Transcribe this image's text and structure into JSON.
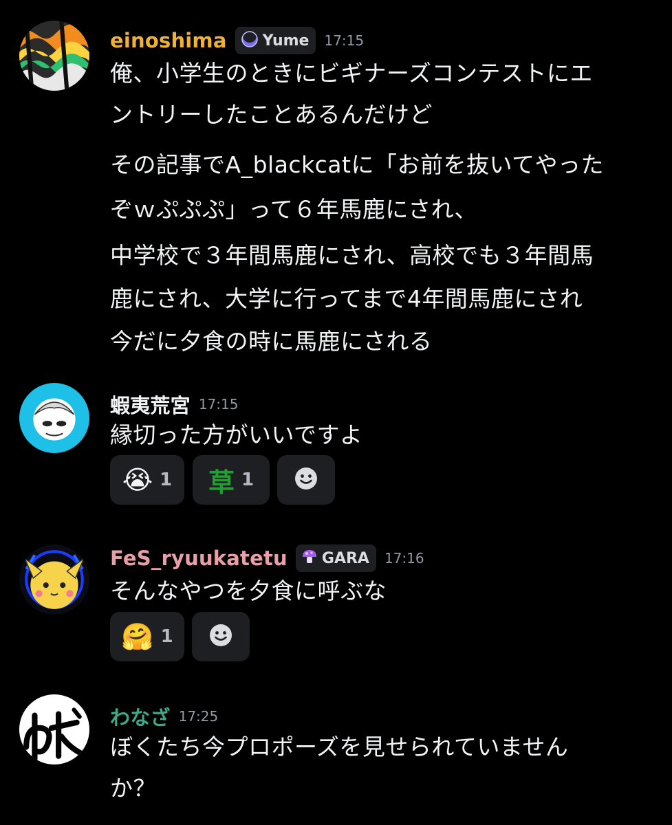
{
  "messages": [
    {
      "username": "einoshima",
      "username_color": "#f0b232",
      "tag": "Yume",
      "tag_icon": "moon-icon",
      "time": "17:15",
      "lines": [
        "俺、小学生のときにビギナーズコンテストにエ",
        "ントリーしたことあるんだけど",
        "その記事でA_blackcatに「お前を抜いてやった",
        "ぞｗぷぷぷ」って６年馬鹿にされ、",
        "中学校で３年間馬鹿にされ、高校でも３年間馬",
        "鹿にされ、大学に行ってまで4年間馬鹿にされ",
        "今だに夕食の時に馬鹿にされる"
      ]
    },
    {
      "username": "蝦夷荒宮",
      "username_color": "#f2f3f5",
      "time": "17:15",
      "lines": [
        "縁切った方がいいですよ"
      ],
      "reactions": [
        {
          "emoji": "😭",
          "count": "1"
        },
        {
          "emoji": "草",
          "count": "1"
        }
      ]
    },
    {
      "username": "FeS_ryuukatetu",
      "username_color": "#e8a0a8",
      "tag": "GARA",
      "tag_icon": "mushroom-icon",
      "time": "17:16",
      "lines": [
        "そんなやつを夕食に呼ぶな"
      ],
      "reactions": [
        {
          "emoji": "🤗",
          "count": "1"
        }
      ]
    },
    {
      "username": "わなざ",
      "username_color": "#3fa88a",
      "time": "17:25",
      "lines": [
        "ぼくたち今プロポーズを見せられていません",
        "か？"
      ]
    }
  ],
  "icons": {
    "add_reaction": "smiley-add-reaction-icon"
  }
}
